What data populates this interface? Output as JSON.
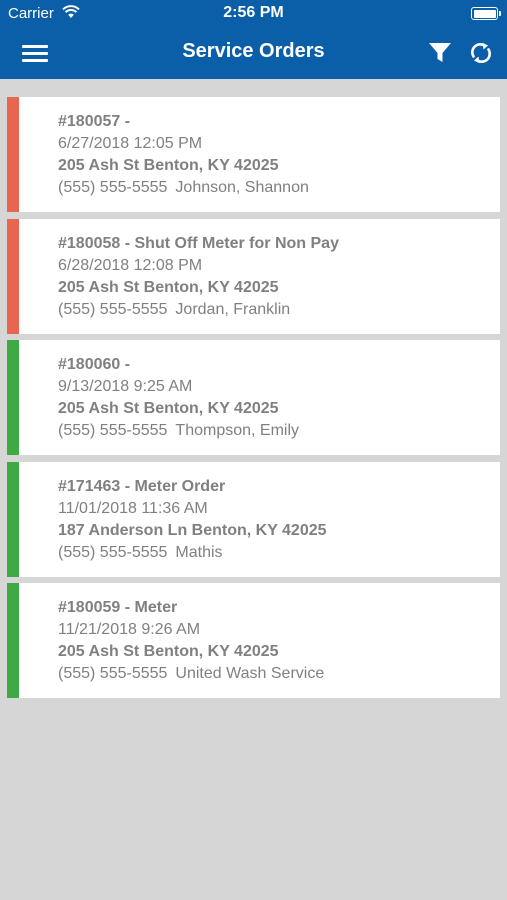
{
  "status_bar": {
    "carrier": "Carrier",
    "time": "2:56 PM"
  },
  "nav": {
    "title": "Service Orders",
    "menu_icon": "hamburger-menu-icon",
    "filter_icon": "filter-icon",
    "refresh_icon": "refresh-icon"
  },
  "colors": {
    "brand": "#0b5ea8",
    "overdue": "#e8654f",
    "ok": "#3faa44",
    "text": "#808080",
    "background": "#d6d6d6"
  },
  "orders": [
    {
      "title": "#180057 -",
      "datetime": "6/27/2018 12:05 PM",
      "address": "205 Ash St Benton, KY 42025",
      "phone": "(555) 555-5555",
      "customer": "Johnson, Shannon",
      "status_color": "#e8654f"
    },
    {
      "title": "#180058 - Shut Off Meter for Non Pay",
      "datetime": "6/28/2018 12:08 PM",
      "address": "205 Ash St Benton, KY 42025",
      "phone": "(555) 555-5555",
      "customer": "Jordan, Franklin",
      "status_color": "#e8654f"
    },
    {
      "title": "#180060 -",
      "datetime": "9/13/2018 9:25 AM",
      "address": "205 Ash St Benton, KY 42025",
      "phone": "(555) 555-5555",
      "customer": "Thompson, Emily",
      "status_color": "#3faa44"
    },
    {
      "title": "#171463 - Meter Order",
      "datetime": "11/01/2018 11:36 AM",
      "address": "187 Anderson Ln Benton, KY 42025",
      "phone": "(555) 555-5555",
      "customer": "Mathis",
      "status_color": "#3faa44"
    },
    {
      "title": "#180059 - Meter",
      "datetime": "11/21/2018 9:26 AM",
      "address": "205 Ash St Benton, KY 42025",
      "phone": "(555) 555-5555",
      "customer": "United Wash Service",
      "status_color": "#3faa44"
    }
  ]
}
